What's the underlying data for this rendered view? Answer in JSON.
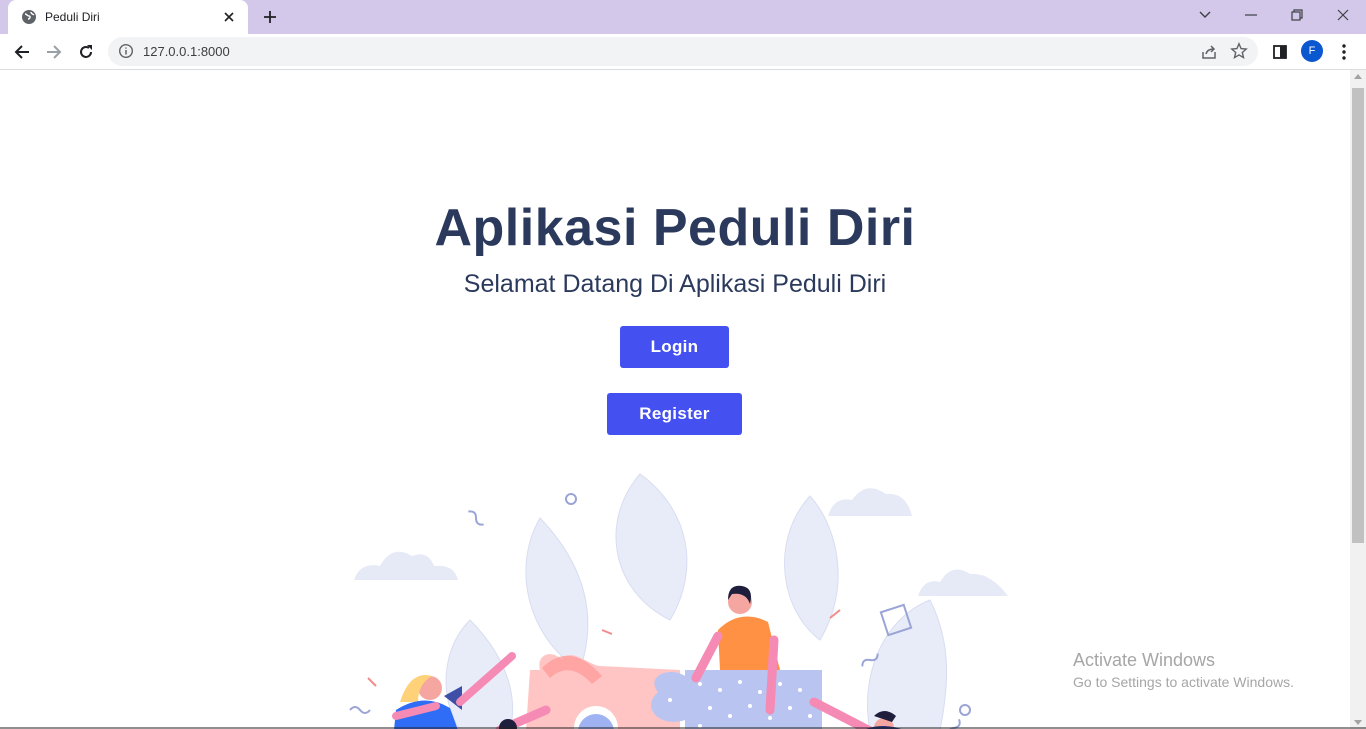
{
  "browser": {
    "tab_title": "Peduli Diri",
    "url": "127.0.0.1:8000",
    "profile_initial": "F",
    "accent_color": "#d3c8ea"
  },
  "page": {
    "title": "Aplikasi Peduli Diri",
    "subtitle": "Selamat Datang Di Aplikasi Peduli Diri",
    "login_label": "Login",
    "register_label": "Register",
    "button_color": "#4450ef",
    "text_color": "#2b3a5c"
  },
  "watermark": {
    "title": "Activate Windows",
    "subtitle": "Go to Settings to activate Windows."
  },
  "icons": [
    "globe-icon",
    "close-icon",
    "plus-icon",
    "chevron-down-icon",
    "minimize-icon",
    "restore-icon",
    "window-close-icon",
    "back-icon",
    "forward-icon",
    "reload-icon",
    "info-icon",
    "share-icon",
    "star-icon",
    "side-panel-icon",
    "more-icon"
  ]
}
